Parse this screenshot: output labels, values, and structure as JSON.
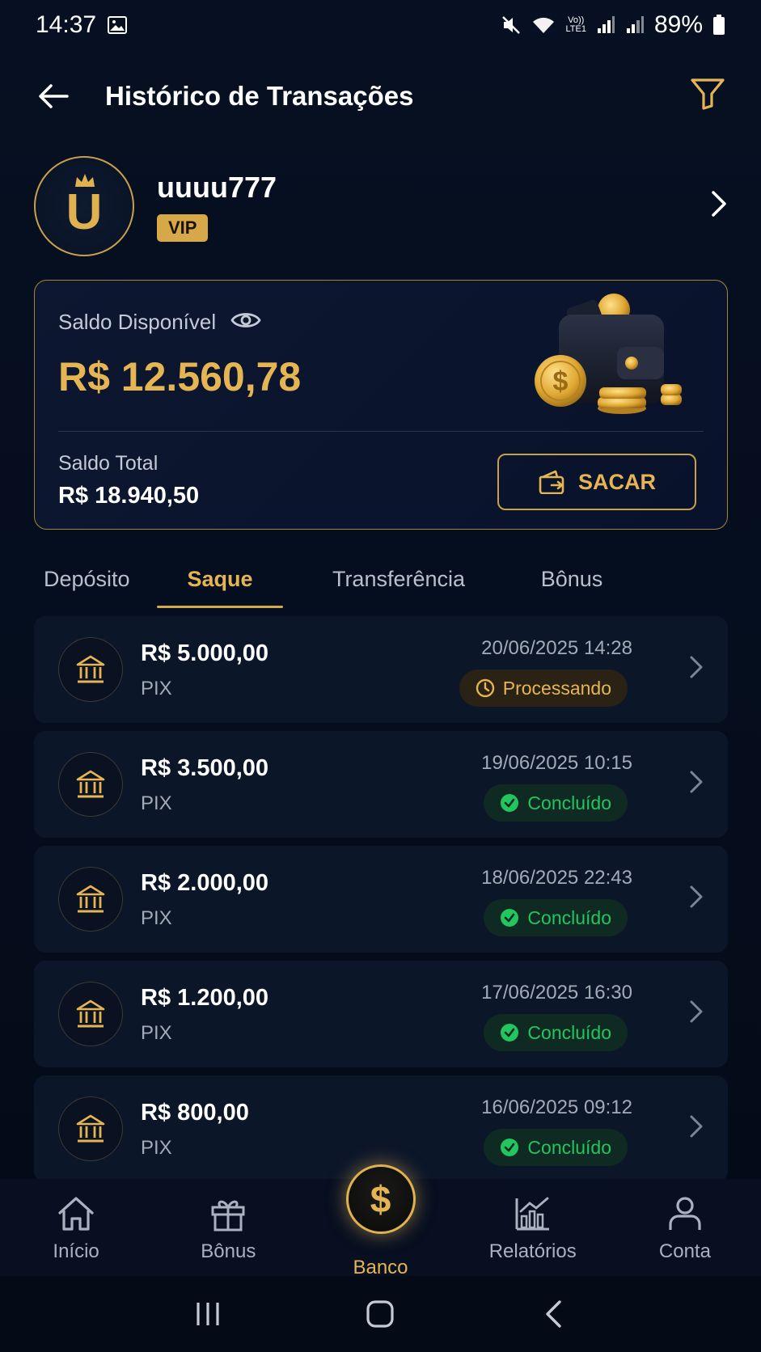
{
  "status_bar": {
    "time": "14:37",
    "battery": "89%",
    "lte_top": "Vo))",
    "lte_bottom": "LTE1"
  },
  "header": {
    "title": "Histórico de Transações"
  },
  "profile": {
    "avatar_letter": "U",
    "username": "uuuu777",
    "badge": "VIP"
  },
  "balance": {
    "available_label": "Saldo Disponível",
    "available_value": "R$ 12.560,78",
    "total_label": "Saldo Total",
    "total_value": "R$ 18.940,50",
    "withdraw_label": "SACAR"
  },
  "tabs": [
    {
      "label": "Depósito",
      "active": false
    },
    {
      "label": "Saque",
      "active": true
    },
    {
      "label": "Transferência",
      "active": false
    },
    {
      "label": "Bônus",
      "active": false
    }
  ],
  "transactions": [
    {
      "amount": "R$ 5.000,00",
      "method": "PIX",
      "datetime": "20/06/2025 14:28",
      "status": "Processando",
      "status_type": "processing"
    },
    {
      "amount": "R$ 3.500,00",
      "method": "PIX",
      "datetime": "19/06/2025 10:15",
      "status": "Concluído",
      "status_type": "done"
    },
    {
      "amount": "R$ 2.000,00",
      "method": "PIX",
      "datetime": "18/06/2025 22:43",
      "status": "Concluído",
      "status_type": "done"
    },
    {
      "amount": "R$ 1.200,00",
      "method": "PIX",
      "datetime": "17/06/2025 16:30",
      "status": "Concluído",
      "status_type": "done"
    },
    {
      "amount": "R$ 800,00",
      "method": "PIX",
      "datetime": "16/06/2025 09:12",
      "status": "Concluído",
      "status_type": "done"
    }
  ],
  "bottom_nav": [
    {
      "label": "Início",
      "icon": "home-icon",
      "active": false
    },
    {
      "label": "Bônus",
      "icon": "gift-icon",
      "active": false
    },
    {
      "label": "Banco",
      "icon": "dollar-coin-icon",
      "active": true,
      "coin_symbol": "$"
    },
    {
      "label": "Relatórios",
      "icon": "chart-icon",
      "active": false
    },
    {
      "label": "Conta",
      "icon": "user-icon",
      "active": false
    }
  ],
  "colors": {
    "accent": "#e6b553",
    "success": "#22c55e",
    "background": "#050c1a",
    "card": "#0c1629"
  }
}
